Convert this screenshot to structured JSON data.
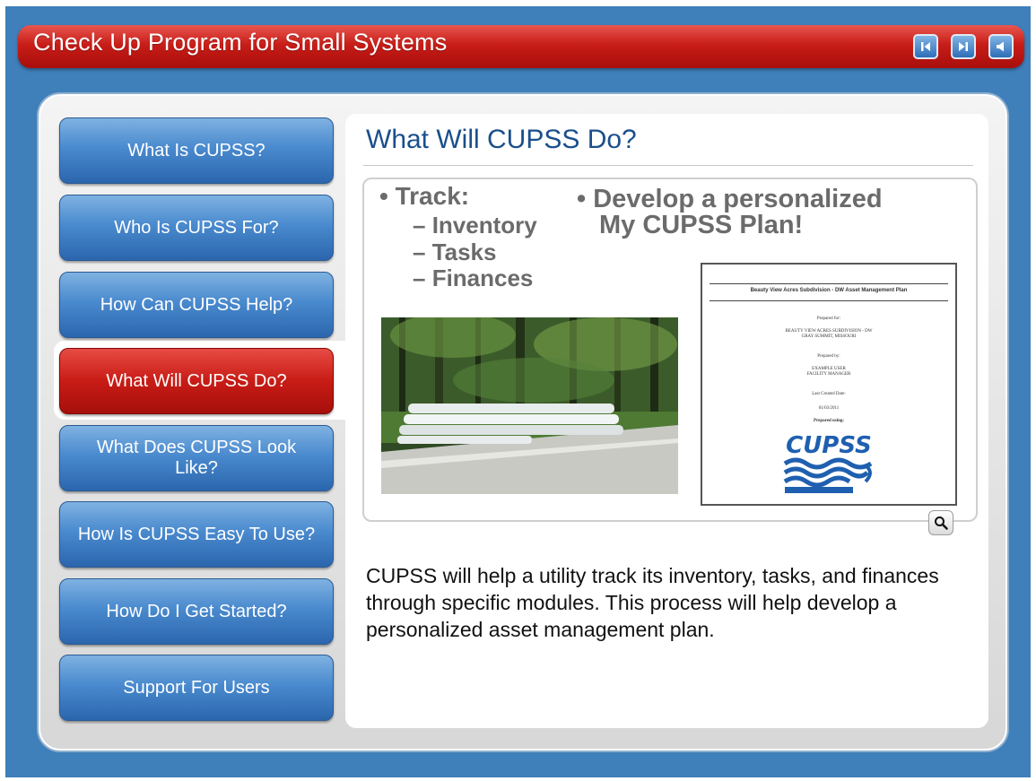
{
  "header": {
    "title": "Check Up Program for Small Systems"
  },
  "nav_buttons": [
    {
      "icon": "previous-icon"
    },
    {
      "icon": "next-icon"
    },
    {
      "icon": "audio-icon"
    }
  ],
  "menu": {
    "items": [
      {
        "label": "What Is CUPSS?"
      },
      {
        "label": "Who Is CUPSS For?"
      },
      {
        "label": "How Can CUPSS Help?"
      },
      {
        "label": "What Will CUPSS Do?",
        "active": true
      },
      {
        "label": "What Does CUPSS Look Like?"
      },
      {
        "label": "How Is CUPSS Easy To Use?"
      },
      {
        "label": "How Do I Get Started?"
      },
      {
        "label": "Support For Users"
      }
    ]
  },
  "main": {
    "title": "What Will CUPSS Do?",
    "slide": {
      "bullet_left": "Track:",
      "sub_items": [
        "Inventory",
        "Tasks",
        "Finances"
      ],
      "bullet_right_line1": "Develop a personalized",
      "bullet_right_line2": "My CUPSS Plan!",
      "document": {
        "heading": "Beauty View Acres Subdivision - DW Asset Management Plan",
        "prepared_for_label": "Prepared for:",
        "prepared_for_line1": "BEAUTY VIEW ACRES SUBDIVISION - DW",
        "prepared_for_line2": "GRAY SUMMIT, MISSOURI",
        "prepared_by_label": "Prepared by:",
        "prepared_by_line1": "EXAMPLE USER",
        "prepared_by_line2": "FACILITY MANAGER",
        "date_label": "Last Created Date:",
        "date_value": "01/03/2011",
        "using_label": "Prepared using:",
        "logo_text": "CUPSS"
      }
    },
    "zoom_icon": "magnifier-icon",
    "description": "CUPSS will help a utility track its inventory, tasks, and finances through specific modules.  This process will help develop a personalized asset management plan."
  },
  "colors": {
    "background": "#3f7fba",
    "header_red": "#c81d18",
    "menu_blue": "#4a8ace",
    "title_blue": "#1a4f8c"
  }
}
